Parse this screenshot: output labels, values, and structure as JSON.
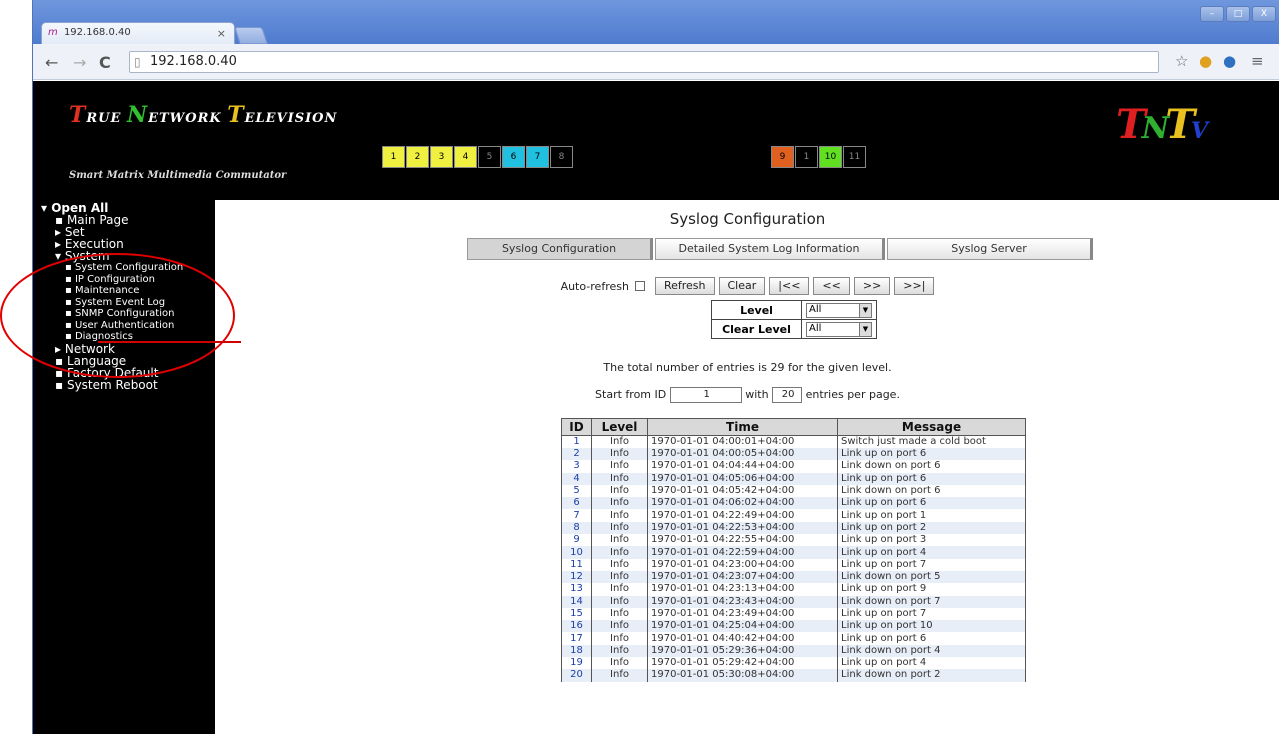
{
  "browser": {
    "tab_title": "192.168.0.40",
    "tab_close": "×",
    "url": "192.168.0.40",
    "window_buttons": [
      "–",
      "□",
      "X"
    ]
  },
  "header": {
    "logo_text": [
      "T",
      "RUE ",
      "N",
      "ETWORK ",
      "T",
      "ELEVISION"
    ],
    "tagline": "Smart Matrix Multimedia Commutator",
    "ports_group1": [
      {
        "label": "1",
        "color": "#f0f040"
      },
      {
        "label": "2",
        "color": "#f0f040"
      },
      {
        "label": "3",
        "color": "#f0f040"
      },
      {
        "label": "4",
        "color": "#f0f040"
      },
      {
        "label": "5",
        "color": "#000000"
      },
      {
        "label": "6",
        "color": "#20c0e0"
      },
      {
        "label": "7",
        "color": "#20c0e0"
      },
      {
        "label": "8",
        "color": "#000000"
      }
    ],
    "ports_group2": [
      {
        "label": "9",
        "color": "#e06020"
      },
      {
        "label": "1",
        "color": "#000000"
      },
      {
        "label": "10",
        "color": "#60e020"
      },
      {
        "label": "11",
        "color": "#000000"
      }
    ],
    "brand": [
      "T",
      "N",
      "T",
      "V"
    ]
  },
  "sidebar": [
    {
      "level": 0,
      "label": "▾ Open All"
    },
    {
      "level": 1,
      "label": "▪ Main Page"
    },
    {
      "level": 1,
      "label": "▸ Set"
    },
    {
      "level": 1,
      "label": "▸ Execution"
    },
    {
      "level": 1,
      "label": "▾ System"
    },
    {
      "level": 2,
      "label": "▪ System Configuration"
    },
    {
      "level": 2,
      "label": "▪ IP Configuration"
    },
    {
      "level": 2,
      "label": "▪ Maintenance"
    },
    {
      "level": 2,
      "label": "▪ System Event Log"
    },
    {
      "level": 2,
      "label": "▪ SNMP Configuration"
    },
    {
      "level": 2,
      "label": "▪ User Authentication"
    },
    {
      "level": 2,
      "label": "▪ Diagnostics"
    },
    {
      "level": 1,
      "label": "▸ Network"
    },
    {
      "level": 1,
      "label": "▪ Language"
    },
    {
      "level": 1,
      "label": "▪ Factory Default"
    },
    {
      "level": 1,
      "label": "▪ System Reboot"
    }
  ],
  "page": {
    "title": "Syslog Configuration",
    "tabs": [
      "Syslog Configuration",
      "Detailed System Log Information",
      "Syslog Server"
    ],
    "auto_refresh_label": "Auto-refresh",
    "buttons": [
      "Refresh",
      "Clear",
      "|<<",
      "<<",
      ">>",
      ">>|"
    ],
    "level_label": "Level",
    "level_value": "All",
    "clear_level_label": "Clear Level",
    "clear_level_value": "All",
    "total_text": "The total number of entries is 29 for the given level.",
    "start_from_label": "Start from ID",
    "start_from_value": "1",
    "with_label": "with",
    "entries_value": "20",
    "per_page_label": "entries per page."
  },
  "log_table": {
    "headers": [
      "ID",
      "Level",
      "Time",
      "Message"
    ],
    "rows": [
      [
        "1",
        "Info",
        "1970-01-01 04:00:01+04:00",
        "Switch just made a cold boot"
      ],
      [
        "2",
        "Info",
        "1970-01-01 04:00:05+04:00",
        "Link up on port 6"
      ],
      [
        "3",
        "Info",
        "1970-01-01 04:04:44+04:00",
        "Link down on port 6"
      ],
      [
        "4",
        "Info",
        "1970-01-01 04:05:06+04:00",
        "Link up on port 6"
      ],
      [
        "5",
        "Info",
        "1970-01-01 04:05:42+04:00",
        "Link down on port 6"
      ],
      [
        "6",
        "Info",
        "1970-01-01 04:06:02+04:00",
        "Link up on port 6"
      ],
      [
        "7",
        "Info",
        "1970-01-01 04:22:49+04:00",
        "Link up on port 1"
      ],
      [
        "8",
        "Info",
        "1970-01-01 04:22:53+04:00",
        "Link up on port 2"
      ],
      [
        "9",
        "Info",
        "1970-01-01 04:22:55+04:00",
        "Link up on port 3"
      ],
      [
        "10",
        "Info",
        "1970-01-01 04:22:59+04:00",
        "Link up on port 4"
      ],
      [
        "11",
        "Info",
        "1970-01-01 04:23:00+04:00",
        "Link up on port 7"
      ],
      [
        "12",
        "Info",
        "1970-01-01 04:23:07+04:00",
        "Link down on port 5"
      ],
      [
        "13",
        "Info",
        "1970-01-01 04:23:13+04:00",
        "Link up on port 9"
      ],
      [
        "14",
        "Info",
        "1970-01-01 04:23:43+04:00",
        "Link down on port 7"
      ],
      [
        "15",
        "Info",
        "1970-01-01 04:23:49+04:00",
        "Link up on port 7"
      ],
      [
        "16",
        "Info",
        "1970-01-01 04:25:04+04:00",
        "Link up on port 10"
      ],
      [
        "17",
        "Info",
        "1970-01-01 04:40:42+04:00",
        "Link up on port 6"
      ],
      [
        "18",
        "Info",
        "1970-01-01 05:29:36+04:00",
        "Link down on port 4"
      ],
      [
        "19",
        "Info",
        "1970-01-01 05:29:42+04:00",
        "Link up on port 4"
      ],
      [
        "20",
        "Info",
        "1970-01-01 05:30:08+04:00",
        "Link down on port 2"
      ]
    ]
  },
  "colors": {
    "accent_red": "#e00000",
    "table_link": "#1a3fa8"
  }
}
